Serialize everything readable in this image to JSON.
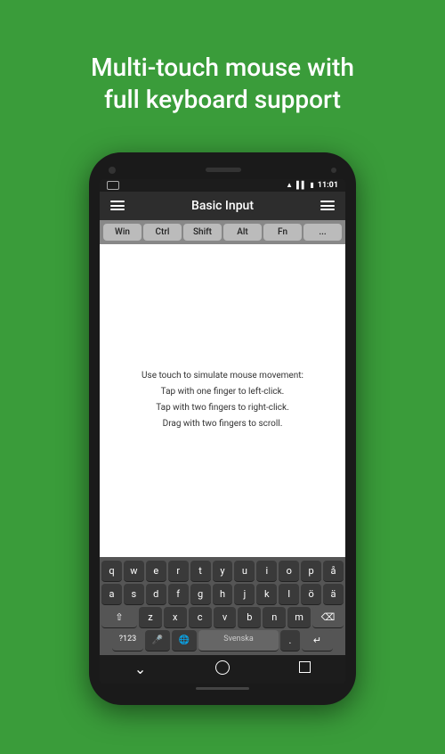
{
  "header": {
    "title": "Multi-touch mouse with\nfull keyboard support"
  },
  "status_bar": {
    "time": "11:01",
    "wifi": "▲",
    "signal": "▌▌▌",
    "battery": "▮"
  },
  "app_bar": {
    "title": "Basic Input",
    "menu_icon": "≡"
  },
  "modifier_keys": [
    "Win",
    "Ctrl",
    "Shift",
    "Alt",
    "Fn",
    "..."
  ],
  "touchpad": {
    "instructions": [
      "Use touch to simulate mouse movement:",
      "Tap with one finger to left-click.",
      "Tap with two fingers to right-click.",
      "Drag with two fingers to scroll."
    ]
  },
  "keyboard": {
    "row1": [
      "q",
      "w",
      "e",
      "r",
      "t",
      "y",
      "u",
      "i",
      "o",
      "p",
      "å"
    ],
    "row2": [
      "a",
      "s",
      "d",
      "f",
      "g",
      "h",
      "j",
      "k",
      "l",
      "ö",
      "ä"
    ],
    "row3_special_left": "⇧",
    "row3": [
      "z",
      "x",
      "c",
      "v",
      "b",
      "n",
      "m"
    ],
    "row3_backspace": "⌫",
    "row4_num": "?123",
    "row4_mic": "🎤",
    "row4_globe": "🌐",
    "row4_space": "Svenska",
    "row4_period": ".",
    "row4_enter": "↵"
  },
  "nav_bar": {
    "back": "⌄",
    "home": "○",
    "recents": "□"
  }
}
